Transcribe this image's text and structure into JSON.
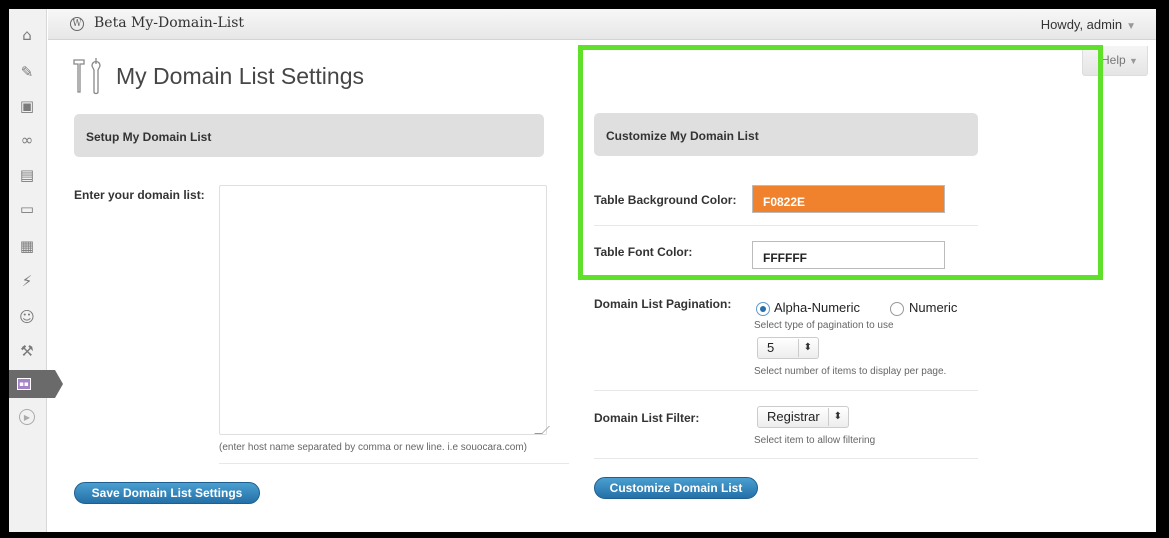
{
  "adminbar": {
    "site_name": "Beta My-Domain-List",
    "howdy": "Howdy, admin",
    "help": "Help"
  },
  "page": {
    "title": "My Domain List Settings"
  },
  "setup_section": {
    "heading": "Setup My Domain List",
    "domain_list_label": "Enter your domain list:",
    "domain_list_value": "",
    "domain_list_hint": "(enter host name separated by comma or new line. i.e souocara.com)",
    "save_button": "Save Domain List Settings"
  },
  "customize_section": {
    "heading": "Customize My Domain List",
    "bg_color_label": "Table Background Color:",
    "bg_color_value": "F0822E",
    "font_color_label": "Table Font Color:",
    "font_color_value": "FFFFFF",
    "pagination_label": "Domain List Pagination:",
    "pagination_options": [
      "Alpha-Numeric",
      "Numeric"
    ],
    "pagination_selected": "Alpha-Numeric",
    "pagination_hint": "Select type of pagination to use",
    "per_page_value": "5",
    "per_page_hint": "Select number of items to display per page.",
    "filter_label": "Domain List Filter:",
    "filter_value": "Registrar",
    "filter_hint": "Select item to allow filtering",
    "customize_button": "Customize Domain List"
  },
  "colors": {
    "bg_swatch": "#F0822E",
    "highlight": "#5FE12A",
    "button": "#2470A8"
  },
  "sidebar_icons": [
    "home-icon",
    "pin-icon",
    "media-icon",
    "links-icon",
    "pages-icon",
    "comments-icon",
    "appearance-icon",
    "plugins-icon",
    "users-icon",
    "tools-icon",
    "plugin-page-icon",
    "collapse-icon"
  ]
}
